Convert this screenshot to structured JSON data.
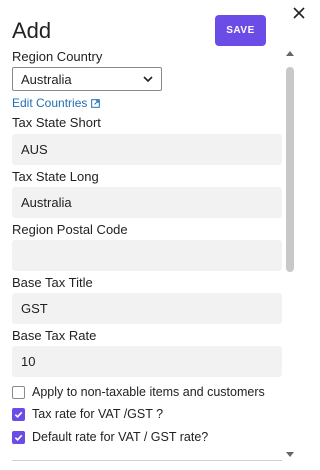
{
  "header": {
    "title": "Add",
    "save_label": "SAVE"
  },
  "form": {
    "region_country": {
      "label": "Region Country",
      "value": "Australia"
    },
    "edit_countries_label": "Edit Countries",
    "tax_state_short": {
      "label": "Tax State Short",
      "value": "AUS"
    },
    "tax_state_long": {
      "label": "Tax State Long",
      "value": "Australia"
    },
    "region_postal_code": {
      "label": "Region Postal Code",
      "value": ""
    },
    "base_tax_title": {
      "label": "Base Tax Title",
      "value": "GST"
    },
    "base_tax_rate": {
      "label": "Base Tax Rate",
      "value": "10"
    },
    "checkboxes": [
      {
        "label": "Apply to non-taxable items and customers",
        "checked": false
      },
      {
        "label": "Tax rate for VAT /GST ?",
        "checked": true
      },
      {
        "label": "Default rate for VAT / GST rate?",
        "checked": true
      }
    ]
  },
  "colors": {
    "accent": "#6b4ce6",
    "link": "#1f6fb5",
    "input_bg": "#f2f2f2"
  },
  "icons": {
    "close": "close-icon",
    "external_link": "external-link-icon",
    "select_arrow": "chevron-down-icon",
    "check": "check-icon"
  }
}
